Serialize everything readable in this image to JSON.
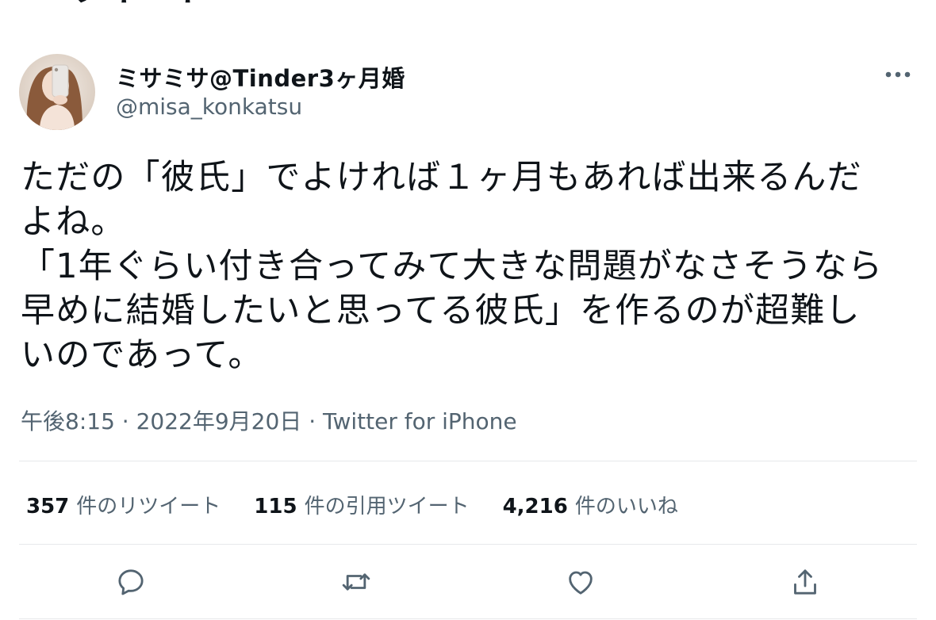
{
  "header": {
    "title": "ツイート"
  },
  "author": {
    "display_name": "ミサミサ@Tinder3ヶ月婚",
    "handle": "@misa_konkatsu"
  },
  "tweet": {
    "lines": [
      "ただの「彼氏」でよければ１ヶ月もあれば出来るんだ",
      "よね。",
      "「1年ぐらい付き合ってみて大きな問題がなさそうなら",
      "早めに結婚したいと思ってる彼氏」を作るのが超難し",
      "いのであって。"
    ]
  },
  "meta": {
    "time": "午後8:15",
    "separator1": " · ",
    "date": "2022年9月20日",
    "separator2": " · ",
    "source": "Twitter for iPhone"
  },
  "stats": {
    "retweets": {
      "count": "357",
      "label": "件のリツイート"
    },
    "quotes": {
      "count": "115",
      "label": "件の引用ツイート"
    },
    "likes": {
      "count": "4,216",
      "label": "件のいいね"
    }
  },
  "icons": {
    "more": "more-icon",
    "reply": "reply-icon",
    "retweet": "retweet-icon",
    "like": "heart-icon",
    "share": "share-icon",
    "back": "back-arrow-icon"
  },
  "colors": {
    "text": "#0f1419",
    "secondary": "#536471",
    "divider": "#e7e9eb"
  }
}
